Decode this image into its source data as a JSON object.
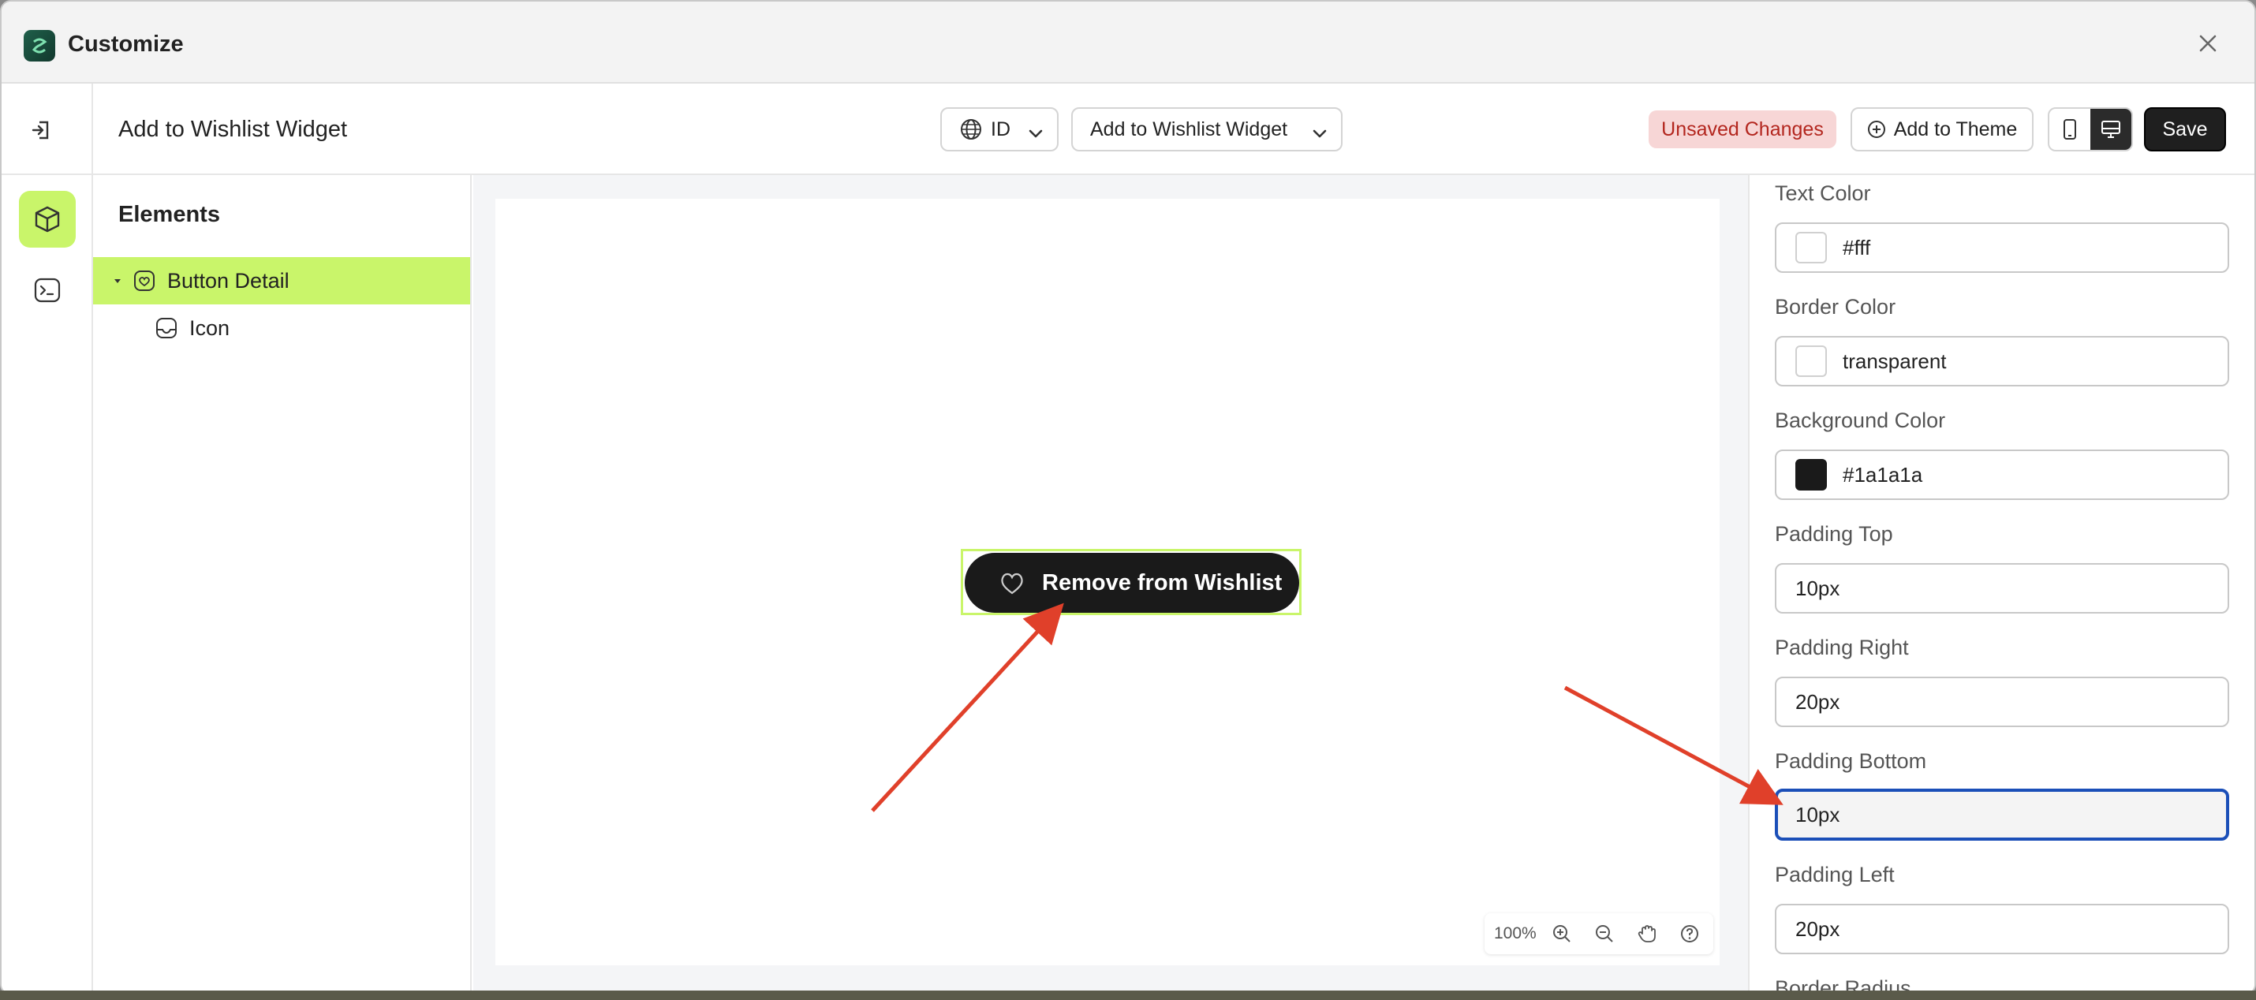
{
  "window": {
    "title": "Customize"
  },
  "toolbar": {
    "page_name": "Add to Wishlist Widget",
    "language_select": "ID",
    "widget_select": "Add to Wishlist Widget",
    "unsaved_badge": "Unsaved Changes",
    "add_to_theme_label": "Add to Theme",
    "save_label": "Save"
  },
  "elements_panel": {
    "title": "Elements",
    "items": [
      {
        "label": "Button Detail",
        "selected": true,
        "icon": "heart-outline-icon"
      },
      {
        "label": "Icon",
        "selected": false,
        "icon": "inbox-icon"
      }
    ]
  },
  "canvas": {
    "preview_button_label": "Remove from Wishlist",
    "zoom_level": "100%"
  },
  "properties": [
    {
      "label": "Text Color",
      "value": "#fff",
      "swatch": "#ffffff"
    },
    {
      "label": "Border Color",
      "value": "transparent",
      "swatch": "#ffffff"
    },
    {
      "label": "Background Color",
      "value": "#1a1a1a",
      "swatch": "#1a1a1a"
    },
    {
      "label": "Padding Top",
      "value": "10px"
    },
    {
      "label": "Padding Right",
      "value": "20px"
    },
    {
      "label": "Padding Bottom",
      "value": "10px",
      "focused": true
    },
    {
      "label": "Padding Left",
      "value": "20px"
    },
    {
      "label": "Border Radius"
    }
  ],
  "colors": {
    "accent": "#c9f56a",
    "save_button": "#1f1f1f",
    "unsaved_bg": "#f7d6d6",
    "unsaved_text": "#b3261e",
    "focus_ring": "#1b4fb8",
    "annotation_arrow": "#e0402a"
  }
}
